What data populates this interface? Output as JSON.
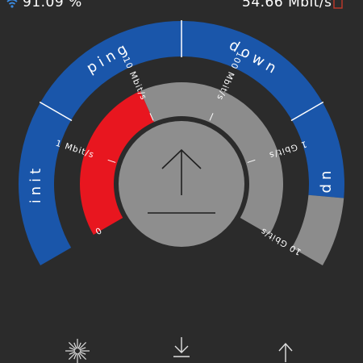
{
  "status_bar": {
    "signal_text": "91.09 %",
    "speed_text": "54.66 Mbit/s"
  },
  "gauge": {
    "outer_segments": [
      "init",
      "ping",
      "down",
      "up"
    ],
    "inner_scale": [
      "0",
      "1 Mbit/s",
      "10 Mbit/s",
      "100 Mbit/s",
      "1 Gbit/s",
      "10 Gbit/s"
    ],
    "progress_fraction": 0.4,
    "current_mode": "upload",
    "center_icon": "upload-arrow-icon"
  },
  "bottom_nav": {
    "items": [
      {
        "name": "ping-burst-icon"
      },
      {
        "name": "download-icon"
      },
      {
        "name": "upload-icon"
      }
    ]
  },
  "colors": {
    "background": "#2b2b2b",
    "outer_ring": "#1a56aa",
    "progress": "#e8161f",
    "inner_track": "#8c8c8c",
    "center_disc": "#8e8e8e",
    "text": "#ffffff"
  }
}
